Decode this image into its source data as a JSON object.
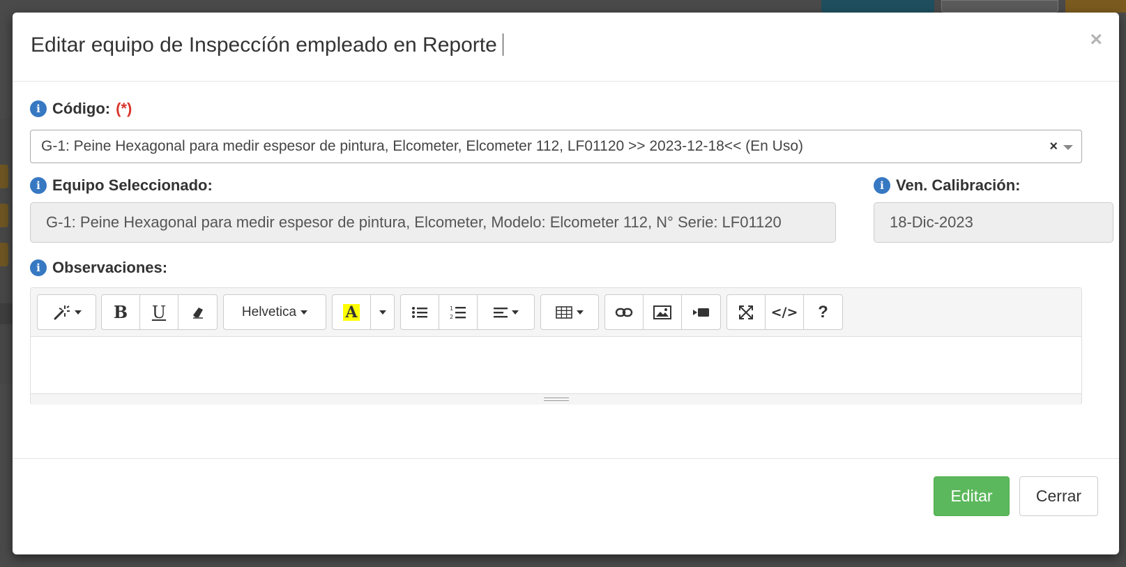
{
  "modal": {
    "title": "Editar equipo de Inspeccíón empleado en Reporte",
    "close_glyph": "×"
  },
  "fields": {
    "codigo": {
      "label": "Código:",
      "required_mark": "(*)",
      "selected_value": "G-1: Peine Hexagonal para medir espesor de pintura, Elcometer, Elcometer 112, LF01120 >> 2023-12-18<< (En Uso)",
      "clear_glyph": "×"
    },
    "equipo_seleccionado": {
      "label": "Equipo Seleccionado:",
      "value": "G-1: Peine Hexagonal para medir espesor de pintura, Elcometer, Modelo: Elcometer 112, N° Serie: LF01120"
    },
    "ven_calibracion": {
      "label": "Ven. Calibración:",
      "value": "18-Dic-2023"
    },
    "observaciones": {
      "label": "Observaciones:",
      "info_glyph": "i"
    }
  },
  "editor_toolbar": {
    "font_name": "Helvetica",
    "bold": "B",
    "underline": "U",
    "highlight": "A",
    "code": "</>",
    "help": "?"
  },
  "footer": {
    "primary_label": "Editar",
    "secondary_label": "Cerrar"
  },
  "colors": {
    "primary_button": "#5cb85c",
    "info_icon": "#3778c2",
    "required": "#d9352b",
    "highlight": "#ffff00"
  }
}
